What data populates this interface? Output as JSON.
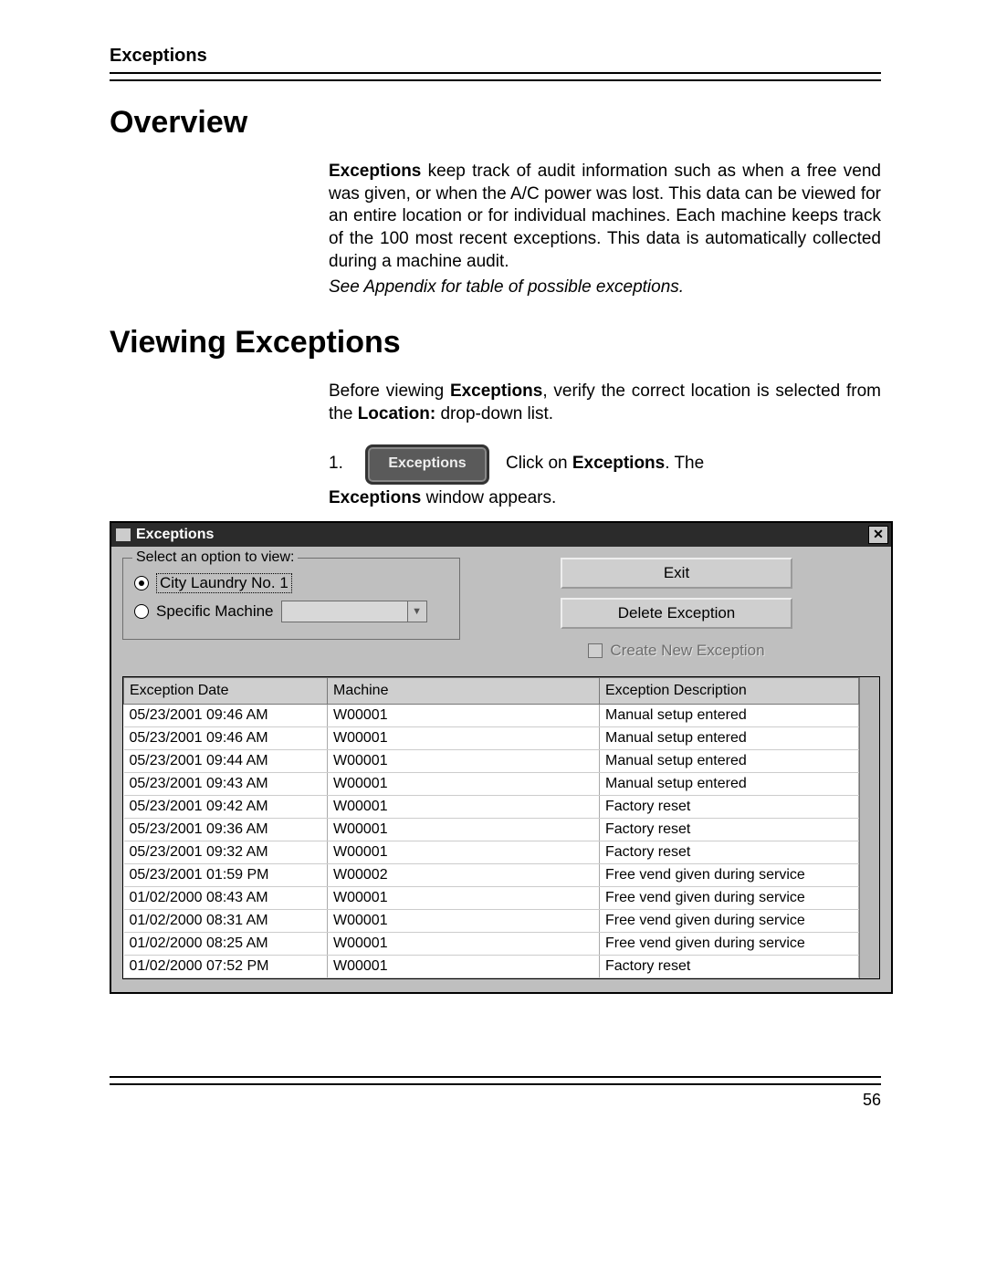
{
  "header": {
    "section": "Exceptions"
  },
  "overview": {
    "heading": "Overview",
    "text1_prefix_bold": "Exceptions",
    "text1_rest": " keep track of audit information such as when a free vend was given, or when the A/C power was lost. This data can be viewed for an entire location or for individual machines. Each machine keeps track of the 100 most recent exceptions. This data is automatically collected during a machine audit.",
    "text_italic": "See Appendix for table of possible exceptions."
  },
  "viewing": {
    "heading": "Viewing Exceptions",
    "intro_pre": "Before viewing ",
    "intro_bold1": "Exceptions",
    "intro_mid": ", verify the correct location is selected from the ",
    "intro_bold2": "Location:",
    "intro_post": " drop-down list.",
    "step_number": "1.",
    "button_label": "Exceptions",
    "step_click_pre": " Click on ",
    "step_click_bold": "Exceptions",
    "step_click_post": ". The",
    "step_line2_bold": "Exceptions",
    "step_line2_post": " window appears."
  },
  "dialog": {
    "title": "Exceptions",
    "close_glyph": "✕",
    "group_legend": "Select an option to view:",
    "radio1": "City Laundry No. 1",
    "radio2": "Specific Machine",
    "combo_arrow": "▼",
    "btn_exit": "Exit",
    "btn_delete": "Delete Exception",
    "checkbox_label": "Create New Exception",
    "columns": {
      "date": "Exception Date",
      "machine": "Machine",
      "desc": "Exception Description"
    },
    "rows": [
      {
        "date": "05/23/2001 09:46 AM",
        "machine": "W00001",
        "desc": "Manual setup entered"
      },
      {
        "date": "05/23/2001 09:46 AM",
        "machine": "W00001",
        "desc": "Manual setup entered"
      },
      {
        "date": "05/23/2001 09:44 AM",
        "machine": "W00001",
        "desc": "Manual setup entered"
      },
      {
        "date": "05/23/2001 09:43 AM",
        "machine": "W00001",
        "desc": "Manual setup entered"
      },
      {
        "date": "05/23/2001 09:42 AM",
        "machine": "W00001",
        "desc": "Factory reset"
      },
      {
        "date": "05/23/2001 09:36 AM",
        "machine": "W00001",
        "desc": "Factory reset"
      },
      {
        "date": "05/23/2001 09:32 AM",
        "machine": "W00001",
        "desc": "Factory reset"
      },
      {
        "date": "05/23/2001 01:59 PM",
        "machine": "W00002",
        "desc": "Free vend given during service"
      },
      {
        "date": "01/02/2000 08:43 AM",
        "machine": "W00001",
        "desc": "Free vend given during service"
      },
      {
        "date": "01/02/2000 08:31 AM",
        "machine": "W00001",
        "desc": "Free vend given during service"
      },
      {
        "date": "01/02/2000 08:25 AM",
        "machine": "W00001",
        "desc": "Free vend given during service"
      },
      {
        "date": "01/02/2000 07:52 PM",
        "machine": "W00001",
        "desc": "Factory reset"
      }
    ]
  },
  "footer": {
    "page": "56"
  }
}
